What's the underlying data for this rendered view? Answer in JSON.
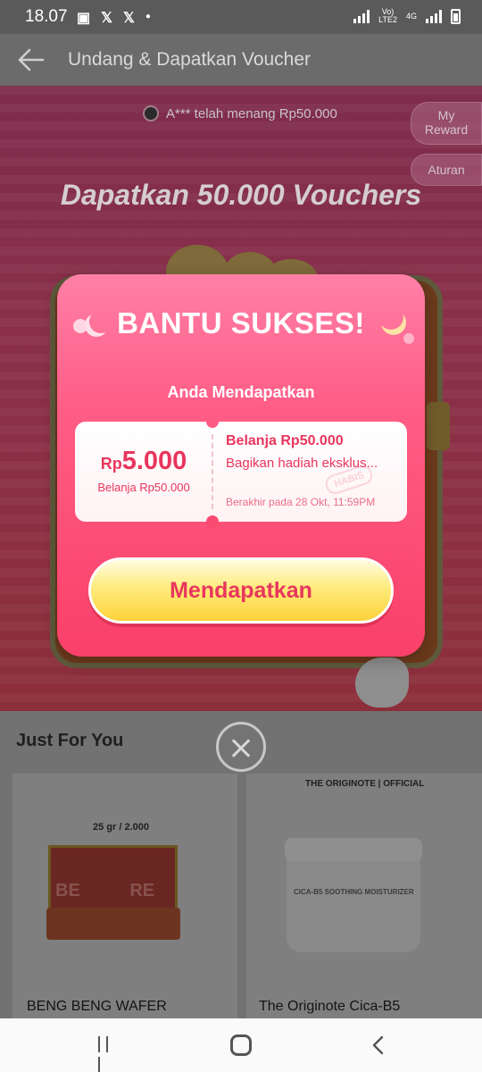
{
  "status_bar": {
    "time": "18.07",
    "icons": [
      "image-icon",
      "x-icon",
      "x-icon",
      "dot-icon"
    ],
    "network_label_1": "Vo)",
    "network_label_2": "LTE2",
    "network_label_3": "4G"
  },
  "app_bar": {
    "back_icon": "arrow-left-icon",
    "title": "Undang & Dapatkan Voucher"
  },
  "campaign": {
    "ticker": "A*** telah menang Rp50.000",
    "my_reward_line1": "My",
    "my_reward_line2": "Reward",
    "rules_label": "Aturan",
    "headline": "Dapatkan 50.000 Vouchers"
  },
  "modal": {
    "title": "BANTU SUKSES!",
    "subtitle": "Anda Mendapatkan",
    "voucher": {
      "currency": "Rp",
      "amount": "5.000",
      "min_spend": "Belanja Rp50.000",
      "name": "Belanja Rp50.000",
      "description": "Bagikan hadiah eksklus...",
      "stamp": "HABIS",
      "expiry": "Berakhir pada 28 Okt, 11:59PM"
    },
    "cta_label": "Mendapatkan",
    "close_icon": "close-icon"
  },
  "just_for_you": {
    "heading": "Just For You",
    "products": [
      {
        "title": "BENG BENG WAFER",
        "badge": "25 gr / 2.000",
        "watermark": "BE          RE"
      },
      {
        "title": "The Originote Cica-B5",
        "brand": "THE ORIGINOTE | OFFICIAL",
        "jar_label": "CICA-B5 SOOTHING MOISTURIZER"
      }
    ]
  },
  "nav_bar": {
    "icons": [
      "recents-icon",
      "home-icon",
      "back-icon"
    ]
  }
}
